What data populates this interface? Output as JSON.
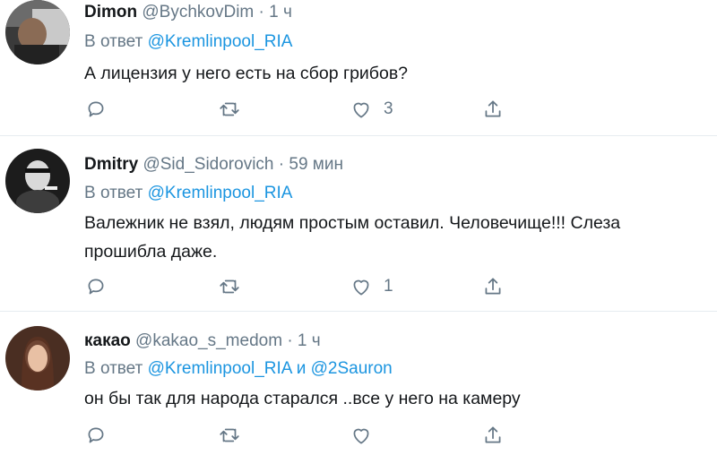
{
  "tweets": [
    {
      "name": "Dimon",
      "handle": "@BychkovDim",
      "dot": "·",
      "time": "1 ч",
      "reply_prefix": "В ответ",
      "reply_to": "@Kremlinpool_RIA",
      "reply_conj": "",
      "reply_to2": "",
      "text": "А лицензия у него есть на сбор грибов?",
      "text2": "",
      "likes": "3",
      "icons": [
        "reply-icon",
        "retweet-icon",
        "like-icon",
        "share-icon"
      ]
    },
    {
      "name": "Dmitry",
      "handle": "@Sid_Sidorovich",
      "dot": "·",
      "time": "59 мин",
      "reply_prefix": "В ответ",
      "reply_to": "@Kremlinpool_RIA",
      "reply_conj": "",
      "reply_to2": "",
      "text": "Валежник не взял, людям простым оставил. Человечище!!! Слеза",
      "text2": "прошибла даже.",
      "likes": "1",
      "icons": [
        "reply-icon",
        "retweet-icon",
        "like-icon",
        "share-icon"
      ]
    },
    {
      "name": "какао",
      "handle": "@kakao_s_medom",
      "dot": "·",
      "time": "1 ч",
      "reply_prefix": "В ответ",
      "reply_to": "@Kremlinpool_RIA",
      "reply_conj": "и",
      "reply_to2": "@2Sauron",
      "text": "он бы так для народа старался ..все у него на камеру",
      "text2": "",
      "likes": "",
      "icons": [
        "reply-icon",
        "retweet-icon",
        "like-icon",
        "share-icon"
      ]
    }
  ],
  "colors": {
    "link": "#1b95e0",
    "muted": "#657786",
    "text": "#14171a",
    "divider": "#e6ecf0"
  }
}
